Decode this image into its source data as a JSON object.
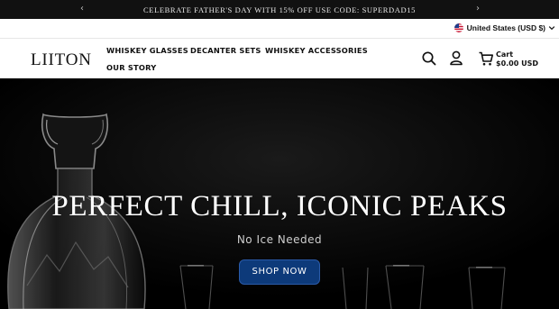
{
  "announcement": {
    "text": "CELEBRATE FATHER'S DAY WITH 15% OFF USE CODE: SUPERDAD15",
    "prev_icon": "chevron-left-icon",
    "next_icon": "chevron-right-icon"
  },
  "locale": {
    "label": "United States (USD $)",
    "flag_icon": "us-flag-icon",
    "dropdown_icon": "chevron-down-icon"
  },
  "header": {
    "logo": "LIITON",
    "nav": [
      {
        "label": "WHISKEY GLASSES"
      },
      {
        "label": "DECANTER SETS"
      },
      {
        "label": "WHISKEY ACCESSORIES"
      },
      {
        "label": "OUR STORY"
      }
    ],
    "cart_label": "Cart",
    "cart_total": "$0.00 USD"
  },
  "hero": {
    "title": "PERFECT CHILL, ICONIC PEAKS",
    "subtitle": "No Ice Needed",
    "cta_label": "SHOP NOW"
  },
  "colors": {
    "announce_bg": "#111111",
    "hero_bg": "#000000",
    "cta_bg": "#0d3a7a"
  }
}
